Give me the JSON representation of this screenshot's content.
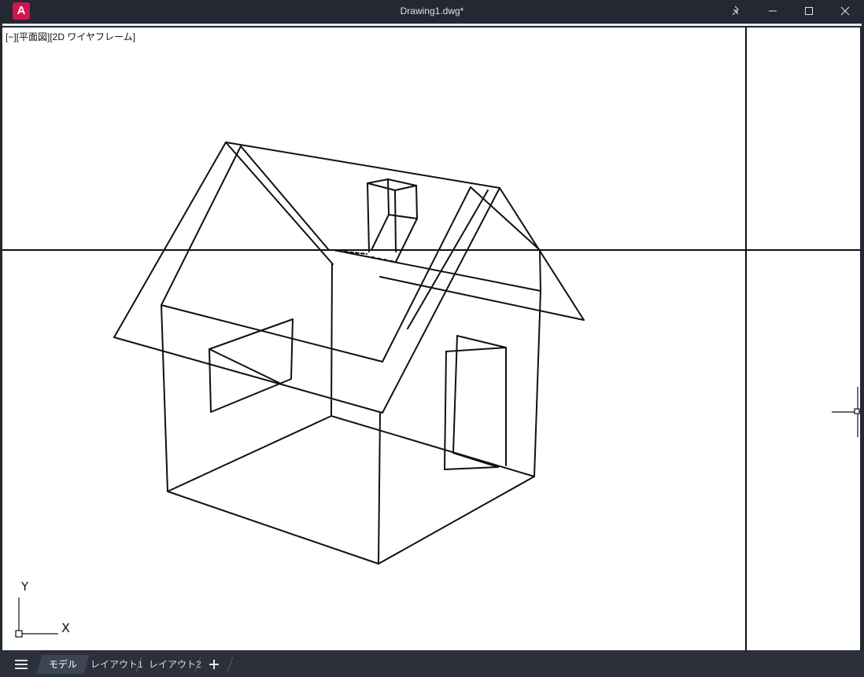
{
  "titlebar": {
    "app_logo": "A",
    "document_title": "Drawing1.dwg*",
    "icons": [
      "pin-icon",
      "minimize-icon",
      "maximize-icon",
      "close-icon"
    ]
  },
  "viewport": {
    "view_label": "[−][平面図][2D ワイヤフレーム]",
    "ucs": {
      "y_label": "Y",
      "x_label": "X"
    },
    "colors": {
      "background": "#ffffff",
      "lines": "#111111"
    }
  },
  "tabs": {
    "items": [
      "モデル",
      "レイアウト1",
      "レイアウト2"
    ],
    "active": "モデル",
    "add_icon": "plus-icon",
    "menu_icon": "hamburger-icon"
  },
  "theme": {
    "chrome": "#232833",
    "accent": "#d1144a"
  }
}
